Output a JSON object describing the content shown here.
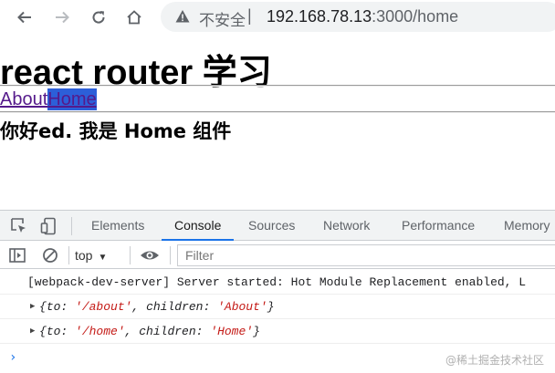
{
  "browser": {
    "security_label": "不安全",
    "separator": "|",
    "url_host": "192.168.78.13",
    "url_path": ":3000/home"
  },
  "page": {
    "title": "react router 学习",
    "links": [
      {
        "label": "About"
      },
      {
        "label": "Home"
      }
    ],
    "greeting": "你好ed. 我是 Home 组件"
  },
  "devtools": {
    "tabs": [
      {
        "label": "Elements"
      },
      {
        "label": "Console"
      },
      {
        "label": "Sources"
      },
      {
        "label": "Network"
      },
      {
        "label": "Performance"
      },
      {
        "label": "Memory"
      }
    ],
    "active_tab": "Console",
    "context": "top",
    "filter_placeholder": "Filter",
    "messages": [
      {
        "text": "[webpack-dev-server] Server started: Hot Module Replacement enabled, L"
      }
    ],
    "objects": [
      {
        "k1": "to",
        "v1": "'/about'",
        "k2": "children",
        "v2": "'About'"
      },
      {
        "k1": "to",
        "v1": "'/home'",
        "k2": "children",
        "v2": "'Home'"
      }
    ],
    "prompt": "›"
  },
  "watermark": "@稀土掘金技术社区"
}
